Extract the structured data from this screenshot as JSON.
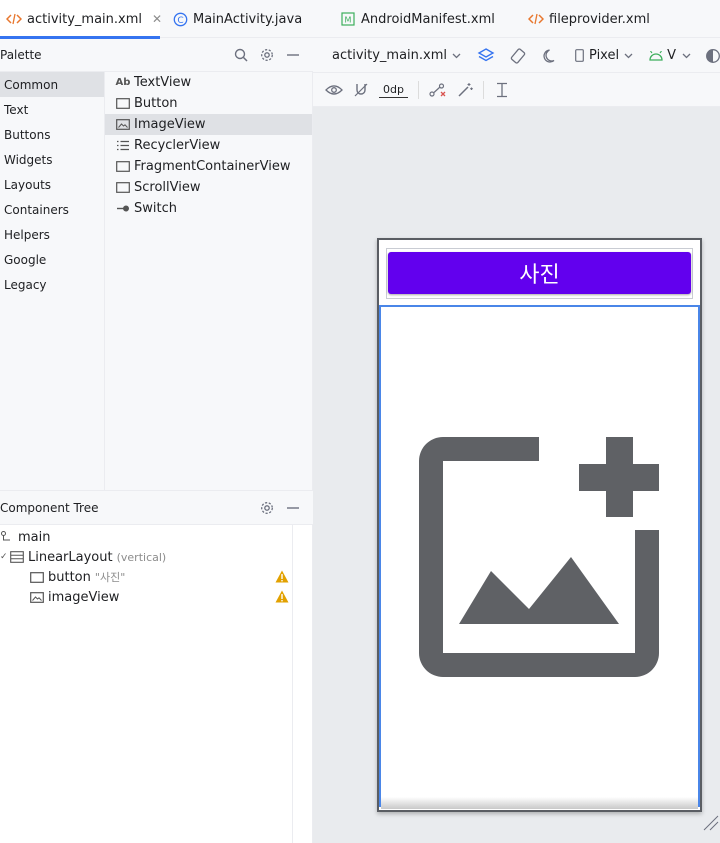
{
  "tabs": [
    {
      "label": "activity_main.xml",
      "icon": "xml-icon",
      "active": true,
      "closable": true
    },
    {
      "label": "MainActivity.java",
      "icon": "class-icon",
      "active": false
    },
    {
      "label": "AndroidManifest.xml",
      "icon": "manifest-icon",
      "active": false
    },
    {
      "label": "fileprovider.xml",
      "icon": "xml-icon",
      "active": false
    }
  ],
  "palette": {
    "title": "Palette",
    "categories": [
      "Common",
      "Text",
      "Buttons",
      "Widgets",
      "Layouts",
      "Containers",
      "Helpers",
      "Google",
      "Legacy"
    ],
    "selected_category": "Common",
    "widgets": [
      {
        "label": "TextView",
        "icon": "textview-icon",
        "glyph": "Ab"
      },
      {
        "label": "Button",
        "icon": "button-icon"
      },
      {
        "label": "ImageView",
        "icon": "imageview-icon",
        "selected": true
      },
      {
        "label": "RecyclerView",
        "icon": "recyclerview-icon"
      },
      {
        "label": "FragmentContainerView",
        "icon": "fragment-icon"
      },
      {
        "label": "ScrollView",
        "icon": "scrollview-icon"
      },
      {
        "label": "Switch",
        "icon": "switch-icon"
      }
    ]
  },
  "component_tree": {
    "title": "Component Tree",
    "root": "main",
    "layout": {
      "label": "LinearLayout",
      "hint": "(vertical)"
    },
    "children": [
      {
        "label": "button",
        "hint": "\"사진\"",
        "warning": true
      },
      {
        "label": "imageView",
        "hint": "",
        "warning": true
      }
    ]
  },
  "design_toolbar": {
    "file": "activity_main.xml",
    "device": "Pixel",
    "api": "V",
    "margin": "0dp"
  },
  "preview": {
    "button_text": "사진",
    "button_color": "#6200ee",
    "image_icon": "add-photo-icon"
  },
  "colors": {
    "accent": "#3574f0",
    "selection_outline": "#4a86e8",
    "warning": "#e2a100"
  }
}
